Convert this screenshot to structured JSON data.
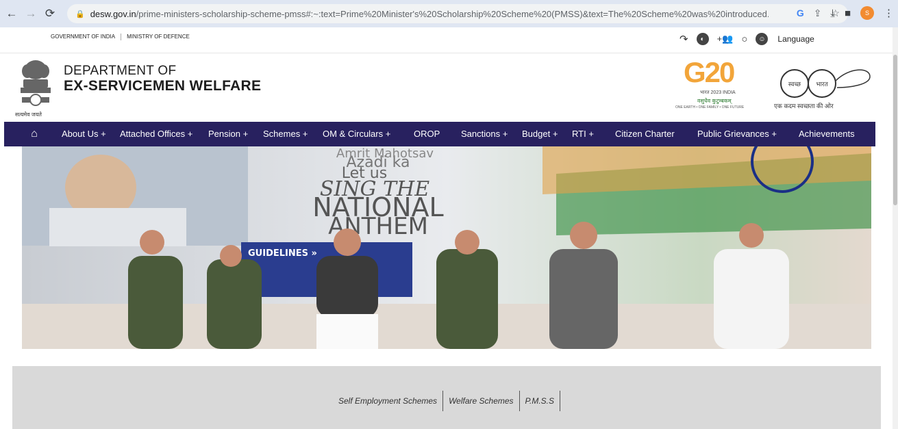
{
  "browser": {
    "url_domain": "desw.gov.in",
    "url_path": "/prime-ministers-scholarship-scheme-pmss#:~:text=Prime%20Minister's%20Scholarship%20Scheme%20(PMSS)&text=The%20Scheme%20was%20introduced...",
    "profile_initial": "S"
  },
  "gov_strip": {
    "government": "GOVERNMENT OF INDIA",
    "ministry": "MINISTRY OF DEFENCE",
    "language": "Language"
  },
  "header": {
    "dept_line1": "DEPARTMENT OF",
    "dept_line2": "EX-SERVICEMEN WELFARE",
    "emblem_caption": "सत्यमेव जयते",
    "g20_title": "G20",
    "g20_sub1": "भारत 2023 INDIA",
    "g20_sub2": "वसुधैव कुटुम्बकम्",
    "g20_sub3": "ONE EARTH • ONE FAMILY • ONE FUTURE",
    "swachh_caption": "एक कदम स्वच्छता की ओर",
    "swachh_left": "स्वच्छ",
    "swachh_right": "भारत"
  },
  "nav": {
    "items": [
      "About Us +",
      "Attached Offices +",
      "Pension +",
      "Schemes +",
      "OM & Circulars +",
      "OROP",
      "Sanctions +",
      "Budget +",
      "RTI +",
      "Citizen Charter",
      "Public Grievances +",
      "Achievements"
    ]
  },
  "banner": {
    "text1": "Azadi ka",
    "text2": "Amrit Mahotsav",
    "text3": "Let us",
    "text4": "SING THE",
    "text5": "NATIONAL",
    "text6": "ANTHEM",
    "text7": "GUIDELINES »"
  },
  "schemes": {
    "links": [
      "Self Employment Schemes",
      "Welfare Schemes",
      "P.M.S.S"
    ]
  },
  "colors": {
    "navbar": "#28215f",
    "chrome": "#dfe6f2",
    "scheme_box": "#d9d9d9"
  }
}
